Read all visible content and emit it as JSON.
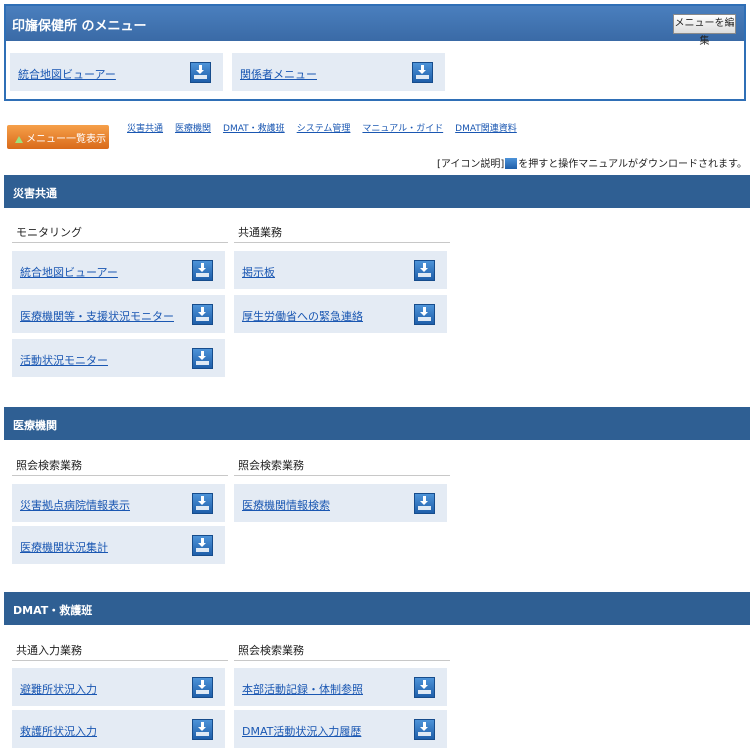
{
  "favorites": {
    "title": "印旛保健所 のメニュー",
    "edit_button": "メニューを編集",
    "items": [
      "統合地図ビューアー",
      "関係者メニュー"
    ]
  },
  "nav": {
    "menu_list_label": "メニュー一覧表示",
    "links": [
      "災害共通",
      "医療機関",
      "DMAT・救護班",
      "システム管理",
      "マニュアル・ガイド",
      "DMAT関連資料"
    ]
  },
  "icon_note": {
    "prefix": "[アイコン説明]",
    "suffix": "を押すと操作マニュアルがダウンロードされます。"
  },
  "sections": [
    {
      "title": "災害共通",
      "groups": [
        {
          "label": "モニタリング",
          "items": [
            "統合地図ビューアー",
            "医療機関等・支援状況モニター",
            "活動状況モニター"
          ]
        },
        {
          "label": "共通業務",
          "items": [
            "掲示板",
            "厚生労働省への緊急連絡"
          ]
        }
      ]
    },
    {
      "title": "医療機関",
      "groups": [
        {
          "label": "照会検索業務",
          "items": [
            "災害拠点病院情報表示",
            "医療機関状況集計"
          ]
        },
        {
          "label": "照会検索業務",
          "items": [
            "医療機関情報検索"
          ]
        }
      ]
    },
    {
      "title": "DMAT・救護班",
      "groups": [
        {
          "label": "共通入力業務",
          "items": [
            "避難所状況入力",
            "救護所状況入力"
          ]
        },
        {
          "label": "照会検索業務",
          "items": [
            "本部活動記録・体制参照",
            "DMAT活動状況入力履歴"
          ]
        }
      ]
    }
  ]
}
